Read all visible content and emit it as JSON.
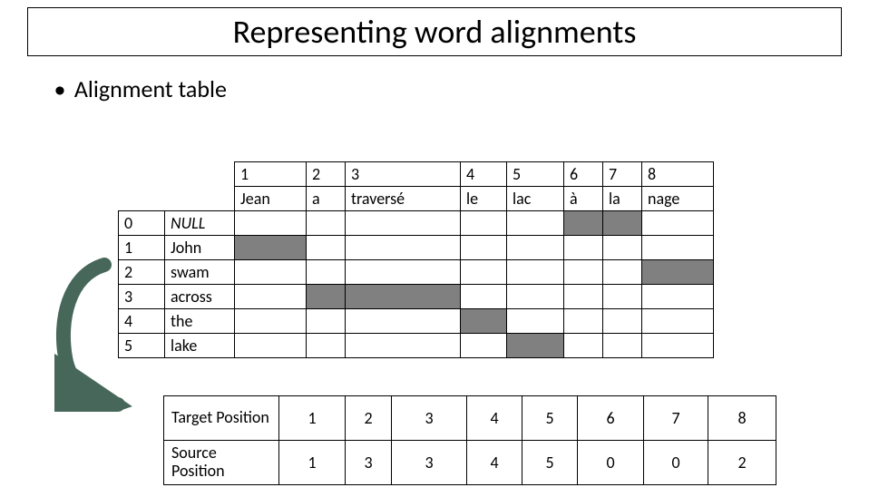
{
  "title": "Representing word alignments",
  "bullet": "Alignment table",
  "chart_data": {
    "type": "table",
    "target_indices": [
      1,
      2,
      3,
      4,
      5,
      6,
      7,
      8
    ],
    "target_words": [
      "Jean",
      "a",
      "traversé",
      "le",
      "lac",
      "à",
      "la",
      "nage"
    ],
    "source_rows": [
      {
        "idx": 0,
        "word": "NULL",
        "aligned_cols": [
          6,
          7
        ]
      },
      {
        "idx": 1,
        "word": "John",
        "aligned_cols": [
          1
        ]
      },
      {
        "idx": 2,
        "word": "swam",
        "aligned_cols": [
          8
        ]
      },
      {
        "idx": 3,
        "word": "across",
        "aligned_cols": [
          2,
          3
        ]
      },
      {
        "idx": 4,
        "word": "the",
        "aligned_cols": [
          4
        ]
      },
      {
        "idx": 5,
        "word": "lake",
        "aligned_cols": [
          5
        ]
      }
    ],
    "position_table": {
      "target_label": "Target Position",
      "source_label": "Source Position",
      "target": [
        1,
        2,
        3,
        4,
        5,
        6,
        7,
        8
      ],
      "source": [
        1,
        3,
        3,
        4,
        5,
        0,
        0,
        2
      ]
    }
  },
  "tgt_idx": {
    "c1": "1",
    "c2": "2",
    "c3": "3",
    "c4": "4",
    "c5": "5",
    "c6": "6",
    "c7": "7",
    "c8": "8"
  },
  "tgt_word": {
    "c1": "Jean",
    "c2": "a",
    "c3": "traversé",
    "c4": "le",
    "c5": "lac",
    "c6": "à",
    "c7": "la",
    "c8": "nage"
  },
  "src": {
    "r0i": "0",
    "r0w": "NULL",
    "r1i": "1",
    "r1w": "John",
    "r2i": "2",
    "r2w": "swam",
    "r3i": "3",
    "r3w": "across",
    "r4i": "4",
    "r4w": "the",
    "r5i": "5",
    "r5w": "lake"
  },
  "pos": {
    "tlabel": "Target Position",
    "slabel": "Source Position",
    "t1": "1",
    "t2": "2",
    "t3": "3",
    "t4": "4",
    "t5": "5",
    "t6": "6",
    "t7": "7",
    "t8": "8",
    "s1": "1",
    "s2": "3",
    "s3": "3",
    "s4": "4",
    "s5": "5",
    "s6": "0",
    "s7": "0",
    "s8": "2"
  }
}
